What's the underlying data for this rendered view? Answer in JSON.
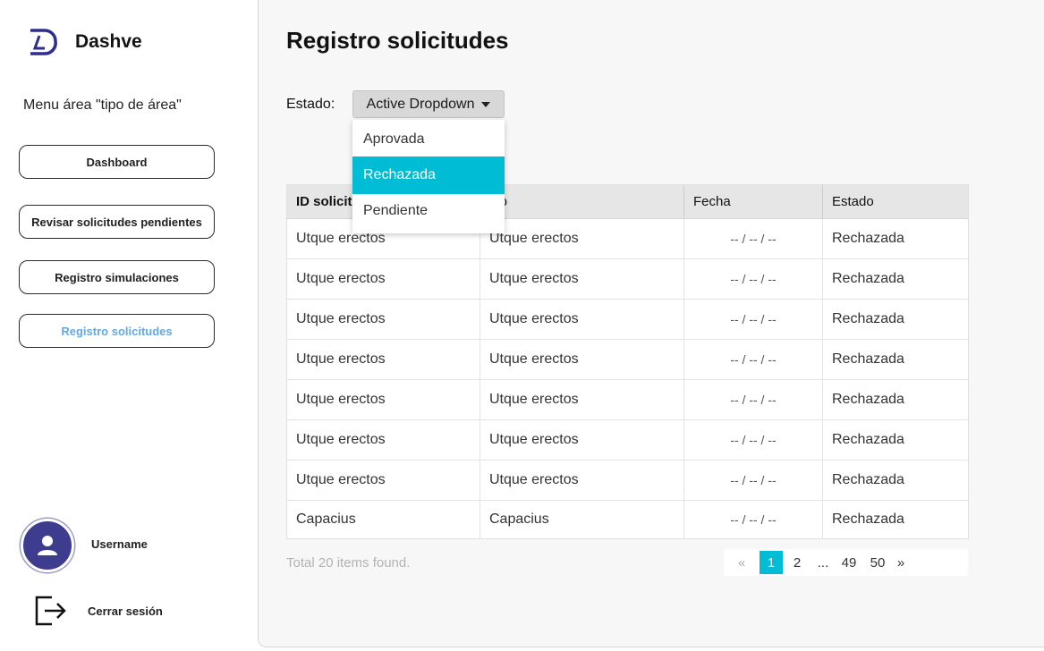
{
  "sidebar": {
    "app_name": "Dashve",
    "menu_title": "Menu área \"tipo de área\"",
    "items": [
      {
        "label": "Dashboard"
      },
      {
        "label": "Revisar solicitudes pendientes"
      },
      {
        "label": "Registro simulaciones"
      },
      {
        "label": "Registro solicitudes",
        "active": true
      }
    ],
    "username": "Username",
    "logout_label": "Cerrar sesión",
    "active_color": "#64a8e8",
    "avatar_color": "#3d3c8f"
  },
  "main": {
    "title": "Registro solicitudes",
    "filter": {
      "label": "Estado:",
      "value": "Active Dropdown",
      "options": [
        "Aprovada",
        "Rechazada",
        "Pendiente"
      ],
      "highlighted": "Rechazada",
      "highlight_color": "#00bcd4"
    },
    "table": {
      "headers": [
        "ID solicit",
        "ulo",
        "Fecha",
        "Estado"
      ],
      "rows": [
        [
          "Utque erectos",
          "Utque erectos",
          "-- / -- / --",
          "Rechazada"
        ],
        [
          "Utque erectos",
          "Utque erectos",
          "-- / -- / --",
          "Rechazada"
        ],
        [
          "Utque erectos",
          "Utque erectos",
          "-- / -- / --",
          "Rechazada"
        ],
        [
          "Utque erectos",
          "Utque erectos",
          "-- / -- / --",
          "Rechazada"
        ],
        [
          "Utque erectos",
          "Utque erectos",
          "-- / -- / --",
          "Rechazada"
        ],
        [
          "Utque erectos",
          "Utque erectos",
          "-- / -- / --",
          "Rechazada"
        ],
        [
          "Utque erectos",
          "Utque erectos",
          "-- / -- / --",
          "Rechazada"
        ],
        [
          "Capacius",
          "Capacius",
          "-- / -- / --",
          "Rechazada"
        ]
      ]
    },
    "total_text": "Total 20 items found.",
    "pagination": {
      "prev": "«",
      "pages": [
        "1",
        "2",
        "...",
        "49",
        "50"
      ],
      "current": "1",
      "next": "»"
    }
  }
}
